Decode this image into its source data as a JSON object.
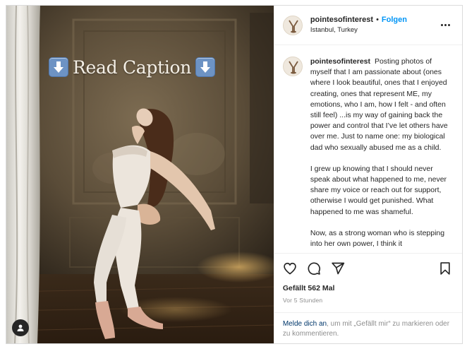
{
  "post": {
    "username": "pointesofinterest",
    "separator": "•",
    "follow_label": "Folgen",
    "location": "Istanbul, Turkey",
    "banner_text": "Read Caption",
    "caption_paragraphs": [
      "Posting photos of myself that I am passionate about (ones where I look beautiful, ones that I enjoyed creating, ones that represent ME, my emotions, who I am, how I felt - and often still feel) ...is my way of gaining back the power and control that I’ve let others have over me. Just to name one: my biological dad who sexually abused me as a child.",
      "I grew up knowing that I should never speak about what happened to me, never share my voice or reach out for support, otherwise I would get punished. What happened to me was shameful.",
      "Now, as a strong woman who is stepping into her own power, I think it"
    ],
    "likes": "Gefällt 562 Mal",
    "time_ago": "Vor 5 Stunden",
    "login_link": "Melde dich an",
    "login_text": ", um mit „Gefällt mir“ zu markieren oder zu kommentieren."
  },
  "icons": {
    "more": "more-options-icon",
    "like": "heart-icon",
    "comment": "comment-icon",
    "share": "paper-plane-icon",
    "save": "bookmark-icon",
    "tags": "user-tag-icon",
    "banner_arrows": "down-arrow-icon"
  },
  "colors": {
    "follow": "#0095f6",
    "link": "#00376b",
    "secondary_text": "#8e8e8e",
    "arrow_emoji": "#6d93c4"
  }
}
